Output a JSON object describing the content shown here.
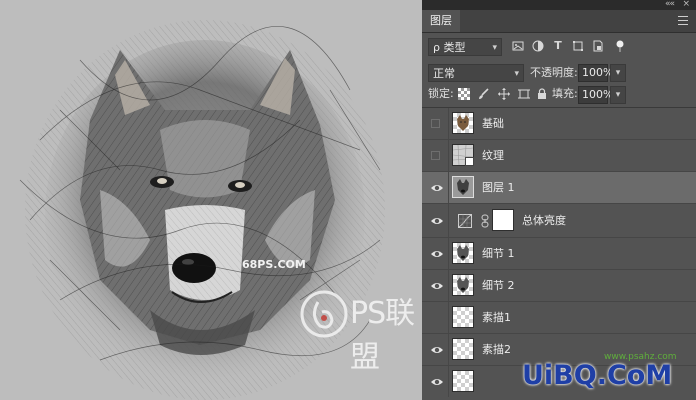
{
  "panel": {
    "collapse_glyph": "««",
    "close_glyph": "×",
    "tab_label": "图层",
    "filter": {
      "label": "ρ 类型"
    },
    "filter_icons": [
      "image-filter-icon",
      "adjustment-filter-icon",
      "text-filter-icon",
      "shape-filter-icon",
      "smart-object-filter-icon",
      "pixel-toggle-icon"
    ],
    "blend_mode": "正常",
    "opacity_label": "不透明度:",
    "opacity_value": "100%",
    "lock_label": "锁定:",
    "fill_label": "填充:",
    "fill_value": "100%"
  },
  "layers": [
    {
      "name": "基础",
      "visible": false,
      "thumb": "wolf-color"
    },
    {
      "name": "纹理",
      "visible": false,
      "thumb": "texture"
    },
    {
      "name": "图层 1",
      "visible": true,
      "selected": true,
      "thumb": "wolf-small"
    },
    {
      "name": "总体亮度",
      "visible": true,
      "thumb": "adjustment"
    },
    {
      "name": "细节 1",
      "visible": true,
      "thumb": "sketch"
    },
    {
      "name": "细节 2",
      "visible": true,
      "thumb": "sketch"
    },
    {
      "name": "素描1",
      "visible": false,
      "thumb": "checker"
    },
    {
      "name": "素描2",
      "visible": true,
      "thumb": "checker"
    }
  ],
  "watermarks": {
    "site": "68PS.COM",
    "ps_logo": "PS联盟",
    "ubq": "UiBQ.CoM",
    "url": "www.psahz.com"
  },
  "colors": {
    "panel_bg": "#535353",
    "selected_row": "#6b6b6b",
    "canvas_bg": "#bdbdbd",
    "ubq_blue": "#1f3fa6"
  }
}
